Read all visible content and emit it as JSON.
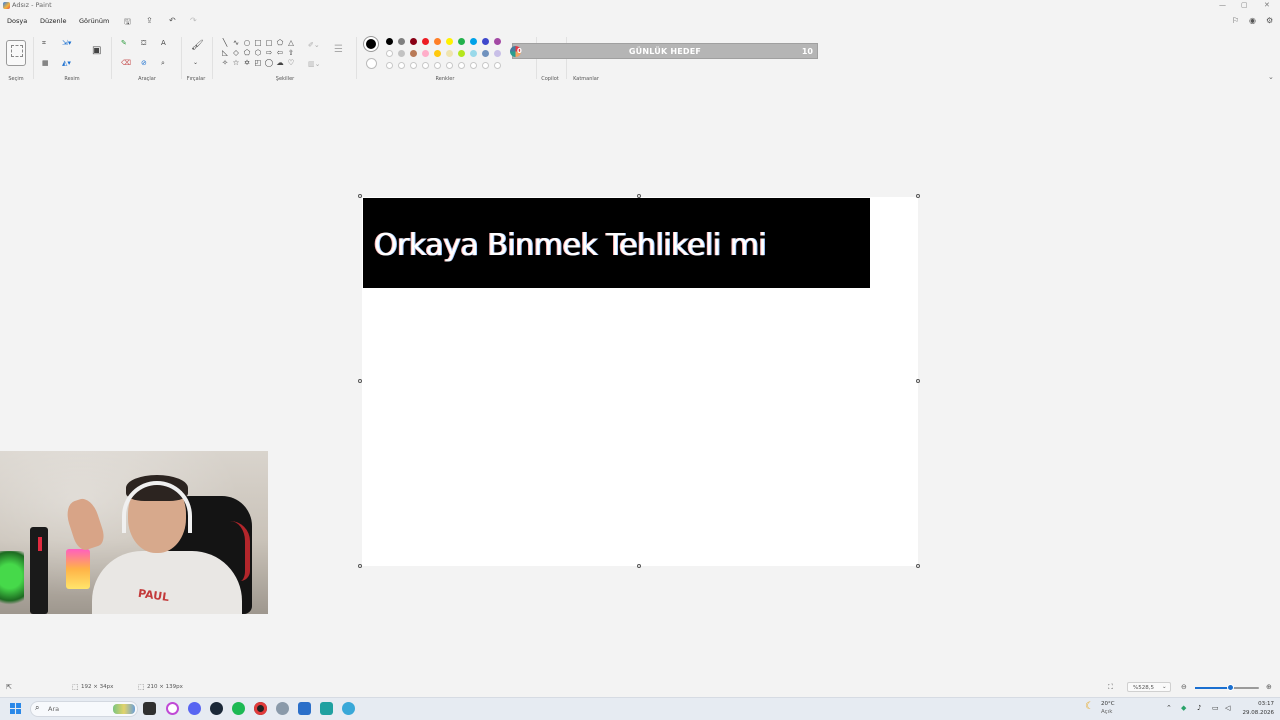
{
  "window": {
    "title": "Adsız - Paint",
    "controls": [
      "—",
      "▢",
      "✕"
    ]
  },
  "menu": {
    "items": [
      "Dosya",
      "Düzenle",
      "Görünüm"
    ]
  },
  "ribbon": {
    "groups": [
      "Seçim",
      "Resim",
      "Araçlar",
      "Fırçalar",
      "Şekiller",
      "Renkler",
      "Copilot",
      "Katmanlar"
    ],
    "palette_row1": [
      "#000000",
      "#7f7f7f",
      "#880015",
      "#ed1c24",
      "#ff7f27",
      "#fff200",
      "#22b14c",
      "#00a2e8",
      "#3f48cc",
      "#a349a4"
    ],
    "palette_row2": [
      "#ffffff",
      "#c3c3c3",
      "#b97a57",
      "#ffaec9",
      "#ffc90e",
      "#efe4b0",
      "#b5e61d",
      "#99d9ea",
      "#7092be",
      "#c8bfe7"
    ],
    "current_color": "#000000"
  },
  "goal_overlay": {
    "title": "GÜNLÜK HEDEF",
    "current": "0",
    "target": "10",
    "progress": 0
  },
  "canvas": {
    "banner_text": "Orkaya Binmek Tehlikeli mi",
    "banner_bg": "#000000",
    "banner_fg": "#ffffff"
  },
  "statusbar": {
    "selection_size": "192 × 34px",
    "canvas_size": "210 × 139px",
    "zoom": "%528,5",
    "zoom_level": 0.55
  },
  "taskbar": {
    "search_placeholder": "Ara",
    "weather_temp": "20°C",
    "weather_desc": "Açık",
    "time": "03:17",
    "date": "29.08.2026"
  }
}
